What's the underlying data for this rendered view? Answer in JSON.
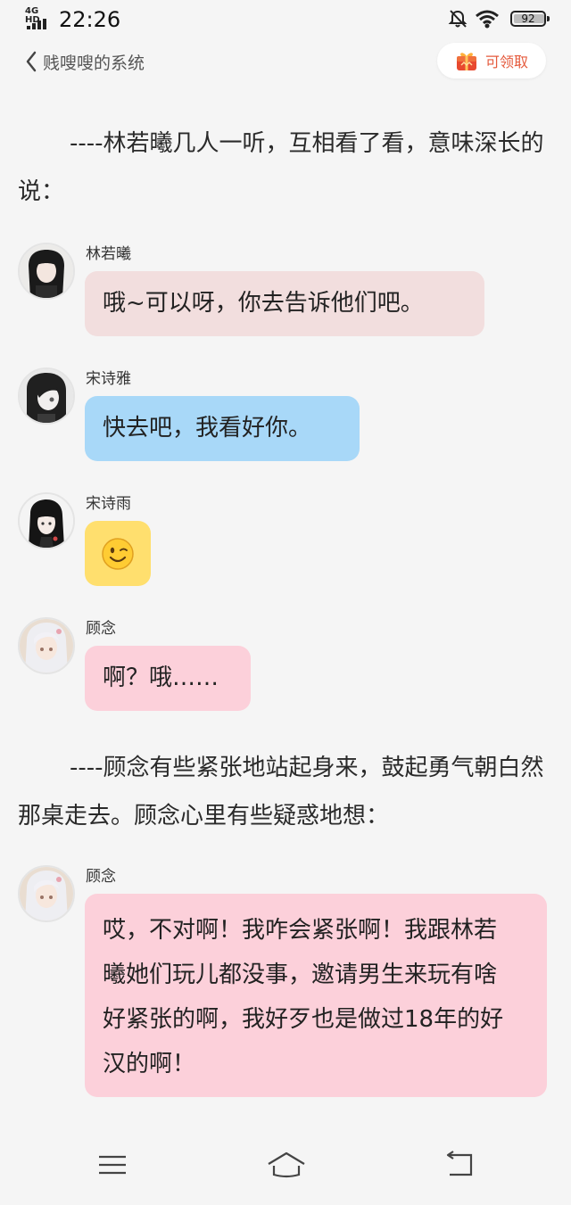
{
  "status_bar": {
    "network": "4G HD",
    "time": "22:26",
    "battery": "92",
    "icons": [
      "signal-bars-icon",
      "mute-bell-icon",
      "wifi-icon",
      "battery-icon"
    ]
  },
  "header": {
    "back_title": "贱嗖嗖的系统",
    "claim_label": "可领取",
    "icons": [
      "back-chevron-icon",
      "gift-icon"
    ]
  },
  "narrations": [
    "----林若曦几人一听，互相看了看，意味深长的说：",
    "----顾念有些紧张地站起身来，鼓起勇气朝白然那桌走去。顾念心里有些疑惑地想："
  ],
  "messages": [
    {
      "name": "林若曦",
      "text": "哦~可以呀，你去告诉他们吧。",
      "bubble_color": "#f2dede"
    },
    {
      "name": "宋诗雅",
      "text": "快去吧，我看好你。",
      "bubble_color": "#a8d8f8"
    },
    {
      "name": "宋诗雨",
      "text": "",
      "emoji": "😉",
      "bubble_color": "#ffdf6e"
    },
    {
      "name": "顾念",
      "text": "啊？哦……",
      "bubble_color": "#fcd0da"
    },
    {
      "name": "顾念",
      "text": "哎，不对啊！我咋会紧张啊！我跟林若曦她们玩儿都没事，邀请男生来玩有啥好紧张的啊，我好歹也是做过18年的好汉的啊！",
      "bubble_color": "#fcd0da"
    }
  ],
  "nav_bar": {
    "icons": [
      "menu-icon",
      "home-icon",
      "back-icon"
    ]
  }
}
